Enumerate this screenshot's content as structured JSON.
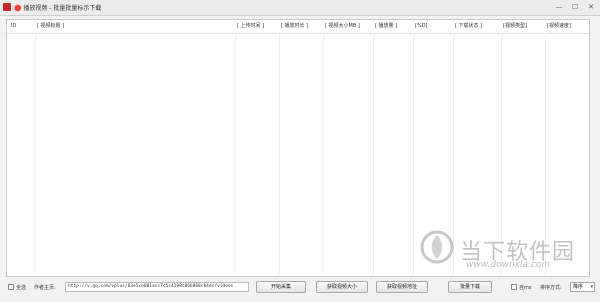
{
  "window": {
    "title": "🔴 播放视频 - 批量批量标示下载",
    "minimize_glyph": "—",
    "maximize_glyph": "☐",
    "close_glyph": "✕"
  },
  "table": {
    "columns": [
      "ID",
      "[ 视频标题 ]",
      "[ 上传时间 ]",
      "[ 播放时长 ]",
      "[ 视频大小MB ]",
      "[ 播放量 ]",
      "[%D]",
      "[ 下载状态 ]",
      "[视频类型]",
      "[视频速度]"
    ],
    "rows": []
  },
  "toolbar": {
    "select_all_label": "全选",
    "homepage_label": "作者主页:",
    "homepage_value": "http://v.qq.com/vplus/83e5ce081acc7c5c4198c06b868cb4dc/videos",
    "start_collect": "开始采集",
    "get_video_size": "获取视频大小",
    "unlock_video_url": "获取视频地址",
    "batch_download": "批量下载",
    "auto_label": "自ms",
    "sort_label": "排序方式:",
    "sort_value": "降序"
  },
  "watermark": {
    "brand": "当下软件园",
    "url": "www.downxia.com"
  },
  "colors": {
    "app_icon": "#c62828",
    "watermark": "#888888"
  }
}
